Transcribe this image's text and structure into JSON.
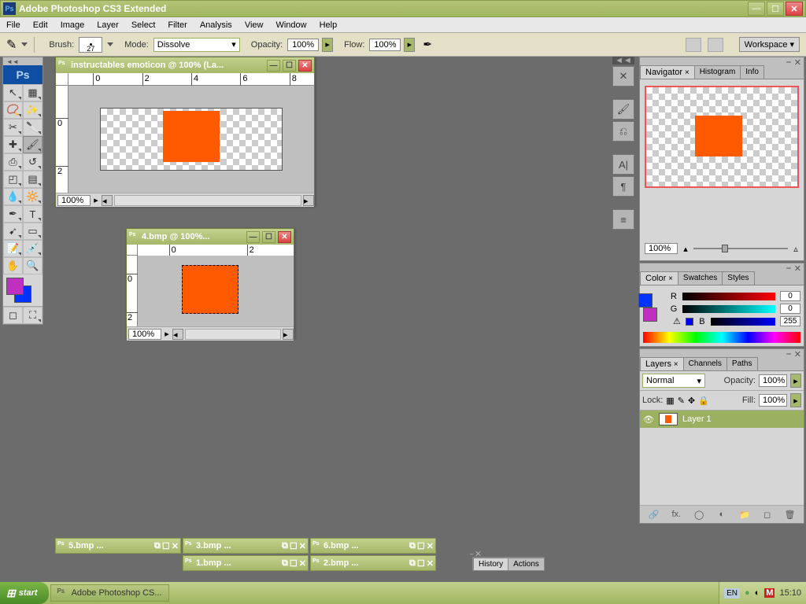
{
  "title": "Adobe Photoshop CS3 Extended",
  "menu": [
    "File",
    "Edit",
    "Image",
    "Layer",
    "Select",
    "Filter",
    "Analysis",
    "View",
    "Window",
    "Help"
  ],
  "options": {
    "brush_size": "27",
    "mode_label": "Mode:",
    "mode_value": "Dissolve",
    "brush_label": "Brush:",
    "opacity_label": "Opacity:",
    "opacity_value": "100%",
    "flow_label": "Flow:",
    "flow_value": "100%",
    "workspace_label": "Workspace"
  },
  "docs": {
    "main": {
      "title": "instructables emoticon @ 100% (La...",
      "zoom": "100%",
      "rulers_h": [
        "0",
        "2",
        "4",
        "6",
        "8"
      ],
      "rulers_v": [
        "0",
        "2"
      ]
    },
    "d4": {
      "title": "4.bmp @ 100%...",
      "zoom": "100%",
      "rulers_h": [
        "0",
        "2"
      ],
      "rulers_v": [
        "0",
        "2"
      ]
    }
  },
  "min_docs": [
    "5.bmp ...",
    "3.bmp ...",
    "6.bmp ...",
    "1.bmp ...",
    "2.bmp ..."
  ],
  "navigator": {
    "tabs": [
      "Navigator",
      "Histogram",
      "Info"
    ],
    "zoom": "100%"
  },
  "color": {
    "tabs": [
      "Color",
      "Swatches",
      "Styles"
    ],
    "r": "0",
    "g": "0",
    "b": "255",
    "r_label": "R",
    "g_label": "G",
    "b_label": "B"
  },
  "layers": {
    "tabs": [
      "Layers",
      "Channels",
      "Paths"
    ],
    "blend": "Normal",
    "opacity_label": "Opacity:",
    "opacity": "100%",
    "lock_label": "Lock:",
    "fill_label": "Fill:",
    "fill": "100%",
    "layer1": "Layer 1"
  },
  "history_tabs": [
    "History",
    "Actions"
  ],
  "taskbar": {
    "start": "start",
    "task": "Adobe Photoshop CS...",
    "lang": "EN",
    "time": "15:10"
  }
}
